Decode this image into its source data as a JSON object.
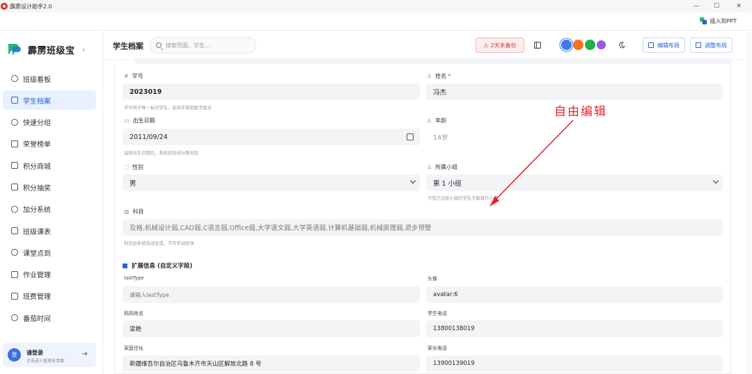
{
  "app": {
    "title": "霹雳设计助手2.0",
    "insert_ppt": "插入到PPT"
  },
  "window_controls": [
    "—",
    "☐",
    "✕"
  ],
  "sidebar": {
    "brand": "霹雳班级宝",
    "collapse_icon": "‹",
    "items": [
      {
        "label": "班级看板",
        "active": false
      },
      {
        "label": "学生档案",
        "active": true
      },
      {
        "label": "快速分组",
        "active": false
      },
      {
        "label": "荣誉榜单",
        "active": false
      },
      {
        "label": "积分商城",
        "active": false
      },
      {
        "label": "积分抽奖",
        "active": false
      },
      {
        "label": "加分系统",
        "active": false
      },
      {
        "label": "班级课表",
        "active": false
      },
      {
        "label": "课堂点到",
        "active": false
      },
      {
        "label": "作业管理",
        "active": false
      },
      {
        "label": "班费管理",
        "active": false
      },
      {
        "label": "番茄时间",
        "active": false
      }
    ],
    "login": {
      "avatar": "登",
      "title": "请登录",
      "subtitle": "点击进入管理员页面"
    }
  },
  "header": {
    "title": "学生档案",
    "search_placeholder": "搜索页面、学生...",
    "backup": "2天未备份",
    "theme_colors": [
      "#3b7bea",
      "#f5731f",
      "#21b04b",
      "#9b59e6"
    ],
    "edit_layout": "编辑布局",
    "adjust_layout": "调整布局"
  },
  "form": {
    "student_id": {
      "label": "学号",
      "value": "2023019",
      "hint": "学号用于唯一标识学生，支持字母和数字组合"
    },
    "name": {
      "label": "姓名",
      "required": "*",
      "value": "冯杰"
    },
    "birth": {
      "label": "出生日期",
      "value": "2011/09/24",
      "hint": "选择出生日期后，系统将自动计算年龄"
    },
    "age": {
      "label": "年龄",
      "value": "14岁"
    },
    "gender": {
      "label": "性别",
      "value": "男"
    },
    "group": {
      "label": "所属小组",
      "value": "第 1 小组",
      "hint": "只有已分配小组的学生才能晋升小组"
    },
    "subjects": {
      "label": "科目",
      "value": "及格,机械设计弱,CAD弱,C语言弱,Office弱,大学语文弱,大学英语弱,计算机基础弱,机械原理弱,退步预警",
      "hint": "科目由系统自动生成，不可手动修改"
    },
    "extended_title": "扩展信息 (自定义字段)",
    "last_type": {
      "label": "lastType",
      "placeholder": "请输入lastType"
    },
    "avatar": {
      "label": "头像",
      "value": "avatar:6"
    },
    "mother_name": {
      "label": "妈妈姓名",
      "value": "梁艳"
    },
    "student_phone": {
      "label": "学生电话",
      "value": "13800138019"
    },
    "home_address": {
      "label": "家庭住址",
      "value": "新疆维吾尔自治区乌鲁木齐市天山区解放北路 8 号"
    },
    "parent_phone": {
      "label": "家长电话",
      "value": "13900139019"
    }
  },
  "annotation": {
    "text": "自由编辑",
    "color": "#e8232e"
  }
}
